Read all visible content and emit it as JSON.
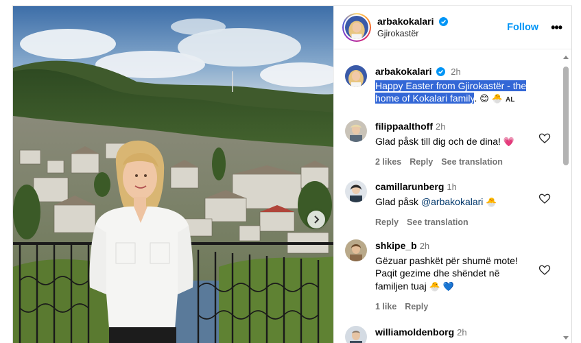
{
  "post": {
    "author": "arbakokalari",
    "location": "Gjirokastër",
    "follow_label": "Follow",
    "more_label": "•••"
  },
  "caption": {
    "username": "arbakokalari",
    "time": "2h",
    "text_highlighted": "Happy Easter from Gjirokastër - the home of Kokalari family",
    "text_tail": ".",
    "emojis": "😊 🐣",
    "al_tag": "AL"
  },
  "comments": [
    {
      "username": "filippaalthoff",
      "time": "2h",
      "text": "Glad påsk till dig och de dina! ",
      "emoji": "💗",
      "likes": "2 likes",
      "reply": "Reply",
      "translate": "See translation"
    },
    {
      "username": "camillarunberg",
      "time": "1h",
      "text_prefix": "Glad påsk ",
      "mention": "@arbakokalari",
      "emoji": "🐣",
      "reply": "Reply",
      "translate": "See translation"
    },
    {
      "username": "shkipe_b",
      "time": "2h",
      "line1": "Gëzuar pashkët për shumë mote!",
      "line2": "Paqit gezime dhe shëndet në",
      "line3": "familjen tuaj",
      "emoji": "🐣 💙",
      "likes": "1 like",
      "reply": "Reply"
    },
    {
      "username": "williamoldenborg",
      "time": "2h"
    }
  ],
  "colors": {
    "accent": "#0095f6",
    "verified": "#0095f6",
    "heart_emoji": "#e0245e",
    "selection": "#3367d6"
  }
}
